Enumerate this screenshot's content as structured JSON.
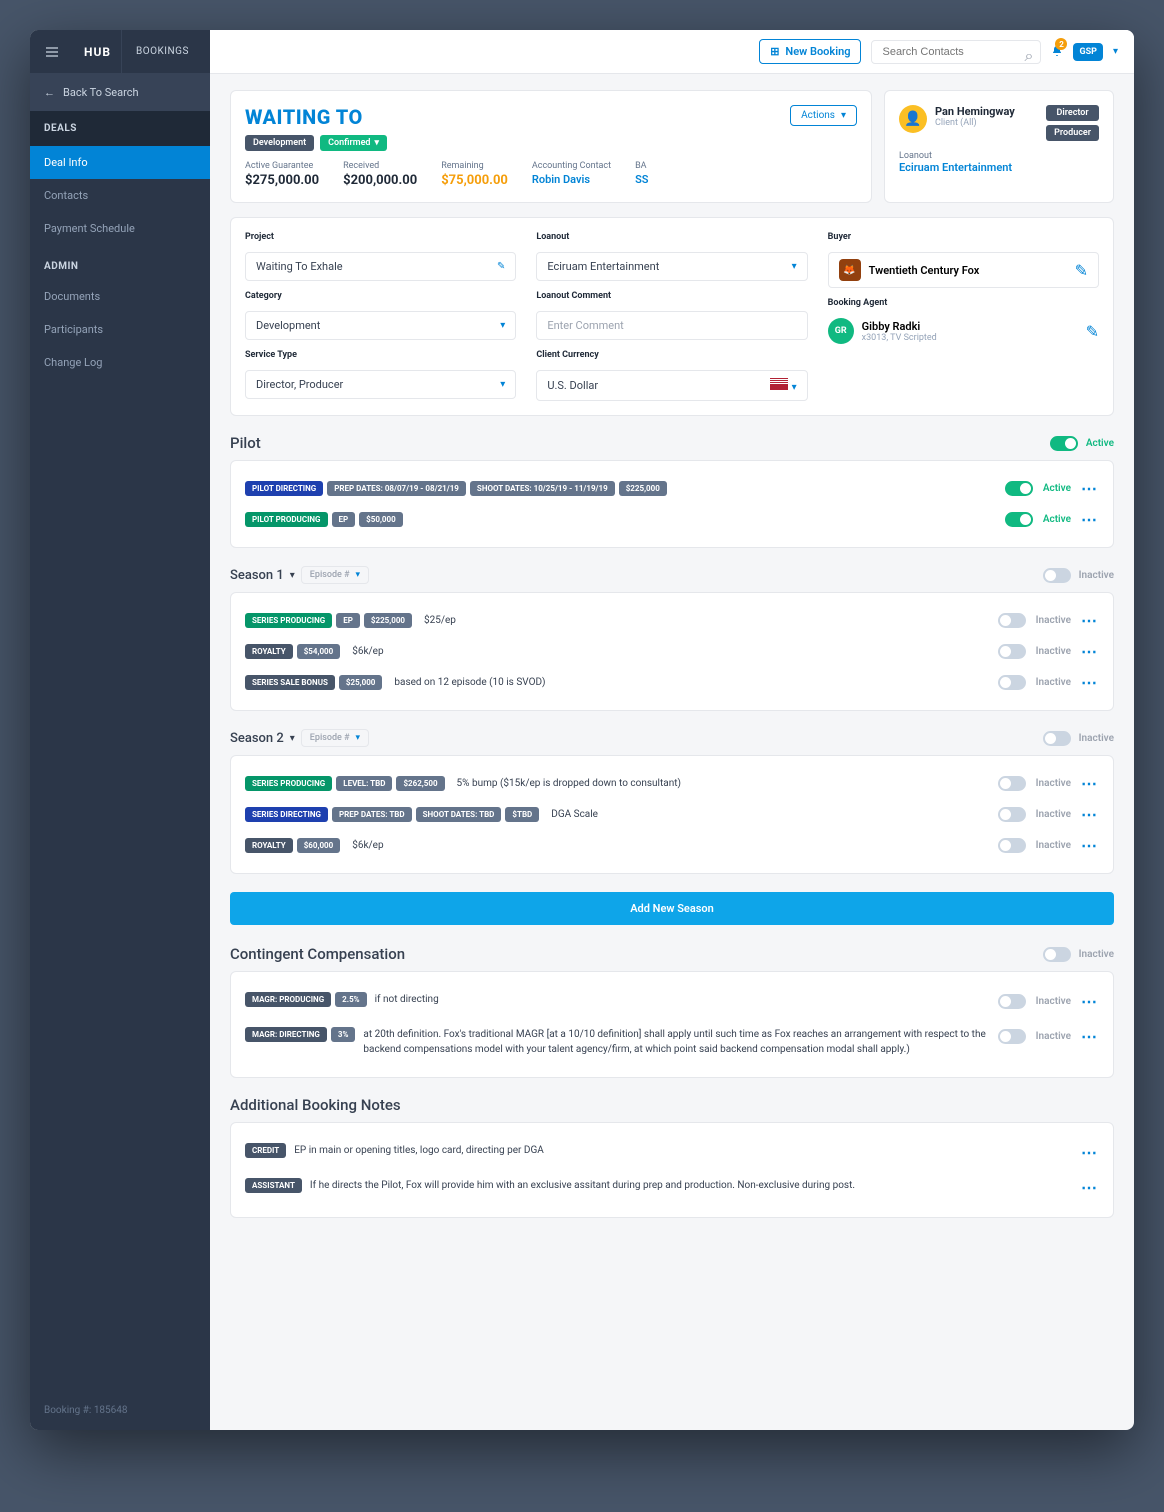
{
  "sidebar": {
    "logo": "HUB",
    "bookings": "BOOKINGS",
    "back": "Back To Search",
    "deals_hdr": "DEALS",
    "deal_items": [
      "Deal Info",
      "Contacts",
      "Payment Schedule"
    ],
    "admin_hdr": "ADMIN",
    "admin_items": [
      "Documents",
      "Participants",
      "Change Log"
    ],
    "footer": "Booking #: 185648"
  },
  "topbar": {
    "new_booking": "New Booking",
    "search_placeholder": "Search Contacts",
    "notif_count": "2",
    "user": "GSP"
  },
  "deal": {
    "title": "WAITING TO",
    "tag_dev": "Development",
    "tag_conf": "Confirmed",
    "actions": "Actions",
    "metrics": [
      {
        "lbl": "Active Guarantee",
        "val": "$275,000.00"
      },
      {
        "lbl": "Received",
        "val": "$200,000.00"
      },
      {
        "lbl": "Remaining",
        "val": "$75,000.00",
        "orange": true
      },
      {
        "lbl": "Accounting Contact",
        "val": "Robin Davis",
        "link": true
      },
      {
        "lbl": "BA",
        "val": "SS",
        "link": true
      }
    ]
  },
  "client": {
    "name": "Pan Hemingway",
    "sub": "Client (All)",
    "roles": [
      "Director",
      "Producer"
    ],
    "loanout_lbl": "Loanout",
    "loanout": "Eciruam Entertainment"
  },
  "details": {
    "project_lbl": "Project",
    "project": "Waiting To Exhale",
    "category_lbl": "Category",
    "category": "Development",
    "service_lbl": "Service Type",
    "service": "Director, Producer",
    "loanout_lbl": "Loanout",
    "loanout": "Eciruam Entertainment",
    "loanout_comment_lbl": "Loanout Comment",
    "loanout_comment_ph": "Enter Comment",
    "currency_lbl": "Client Currency",
    "currency": "U.S. Dollar",
    "buyer_lbl": "Buyer",
    "buyer": "Twentieth Century Fox",
    "agent_lbl": "Booking Agent",
    "agent_name": "Gibby Radki",
    "agent_sub": "x3013, TV Scripted",
    "agent_init": "GR"
  },
  "pilot": {
    "title": "Pilot",
    "toggle_lbl": "Active",
    "rows": [
      {
        "tags": [
          [
            "PILOT DIRECTING",
            "blue"
          ],
          [
            "PREP DATES: 08/07/19 - 08/21/19",
            "gray"
          ],
          [
            "SHOOT DATES: 10/25/19 - 11/19/19",
            "gray"
          ],
          [
            "$225,000",
            "gray"
          ]
        ],
        "active": true
      },
      {
        "tags": [
          [
            "PILOT PRODUCING",
            "green"
          ],
          [
            "EP",
            "gray"
          ],
          [
            "$50,000",
            "gray"
          ]
        ],
        "active": true
      }
    ]
  },
  "season1": {
    "title": "Season 1",
    "episode_ph": "Episode #",
    "toggle_lbl": "Inactive",
    "rows": [
      {
        "tags": [
          [
            "SERIES PRODUCING",
            "green"
          ],
          [
            "EP",
            "gray"
          ],
          [
            "$225,000",
            "gray"
          ]
        ],
        "note": "$25/ep"
      },
      {
        "tags": [
          [
            "ROYALTY",
            "darkgray"
          ],
          [
            "$54,000",
            "gray"
          ]
        ],
        "note": "$6k/ep"
      },
      {
        "tags": [
          [
            "SERIES SALE BONUS",
            "darkgray"
          ],
          [
            "$25,000",
            "gray"
          ]
        ],
        "note": "based on 12 episode (10 is SVOD)"
      }
    ]
  },
  "season2": {
    "title": "Season 2",
    "episode_ph": "Episode #",
    "toggle_lbl": "Inactive",
    "rows": [
      {
        "tags": [
          [
            "SERIES PRODUCING",
            "green"
          ],
          [
            "LEVEL: TBD",
            "gray"
          ],
          [
            "$262,500",
            "gray"
          ]
        ],
        "note": "5% bump ($15k/ep is dropped down to consultant)"
      },
      {
        "tags": [
          [
            "SERIES DIRECTING",
            "blue"
          ],
          [
            "PREP DATES: TBD",
            "gray"
          ],
          [
            "SHOOT DATES: TBD",
            "gray"
          ],
          [
            "$TBD",
            "gray"
          ]
        ],
        "note": "DGA Scale"
      },
      {
        "tags": [
          [
            "ROYALTY",
            "darkgray"
          ],
          [
            "$60,000",
            "gray"
          ]
        ],
        "note": "$6k/ep"
      }
    ]
  },
  "add_season": "Add New Season",
  "contingent": {
    "title": "Contingent Compensation",
    "toggle_lbl": "Inactive",
    "rows": [
      {
        "tags": [
          [
            "MAGR: PRODUCING",
            "darkgray"
          ],
          [
            "2.5%",
            "gray"
          ]
        ],
        "note": "if not directing"
      },
      {
        "tags": [
          [
            "MAGR: DIRECTING",
            "darkgray"
          ],
          [
            "3%",
            "gray"
          ]
        ],
        "note": "at 20th definition. Fox's traditional MAGR [at a 10/10 definition] shall apply until such time as Fox reaches an arrangement with respect to the backend compensations model with your talent agency/firm, at which point said backend compensation modal shall apply.)"
      }
    ]
  },
  "notes": {
    "title": "Additional Booking Notes",
    "rows": [
      {
        "tag": "CREDIT",
        "note": "EP in main or opening titles, logo card, directing per DGA"
      },
      {
        "tag": "ASSISTANT",
        "note": "If he directs the Pilot, Fox will provide him with an exclusive assitant during prep and production. Non-exclusive during post."
      }
    ]
  }
}
